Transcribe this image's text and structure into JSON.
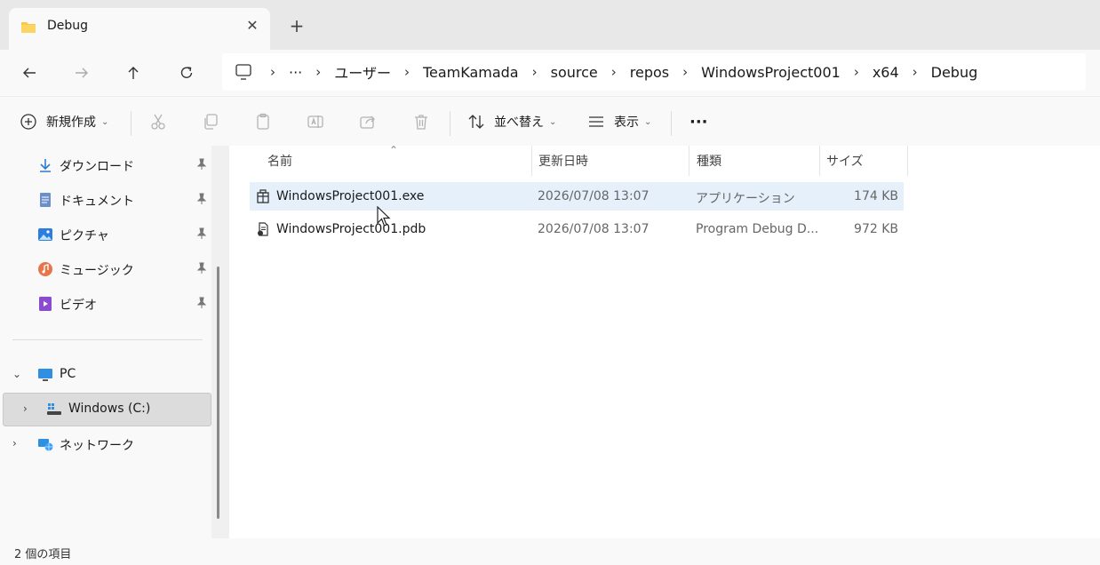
{
  "tab": {
    "title": "Debug",
    "close_glyph": "✕",
    "new_tab_glyph": "+"
  },
  "address": {
    "ellipsis": "···",
    "crumbs": [
      "ユーザー",
      "TeamKamada",
      "source",
      "repos",
      "WindowsProject001",
      "x64",
      "Debug"
    ],
    "separator": "›"
  },
  "commands": {
    "new": "新規作成",
    "sort": "並べ替え",
    "view": "表示",
    "more": "···"
  },
  "sidebar": {
    "quick": [
      {
        "label": "ダウンロード",
        "icon": "download-icon"
      },
      {
        "label": "ドキュメント",
        "icon": "document-icon"
      },
      {
        "label": "ピクチャ",
        "icon": "pictures-icon"
      },
      {
        "label": "ミュージック",
        "icon": "music-icon"
      },
      {
        "label": "ビデオ",
        "icon": "video-icon"
      }
    ],
    "pc": "PC",
    "drive": "Windows (C:)",
    "network": "ネットワーク"
  },
  "columns": {
    "name": "名前",
    "date": "更新日時",
    "type": "種類",
    "size": "サイズ"
  },
  "files": [
    {
      "name": "WindowsProject001.exe",
      "date": "2026/07/08 13:07",
      "type": "アプリケーション",
      "size": "174 KB",
      "selected": true
    },
    {
      "name": "WindowsProject001.pdb",
      "date": "2026/07/08 13:07",
      "type": "Program Debug D...",
      "size": "972 KB",
      "selected": false
    }
  ],
  "status": {
    "count": "2 個の項目"
  },
  "colors": {
    "accent": "#0067c0",
    "selection": "#e5f0fb",
    "folder": "#f8c84a"
  }
}
